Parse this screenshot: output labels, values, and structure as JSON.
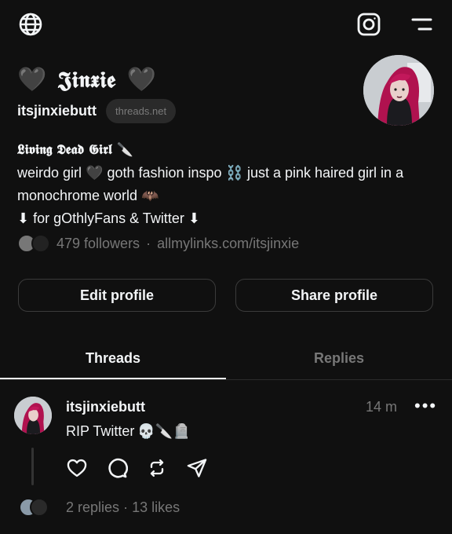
{
  "header": {
    "globe_icon": "globe-icon",
    "instagram_icon": "instagram-icon",
    "menu_icon": "menu-icon"
  },
  "profile": {
    "display_name": "𝕵𝖎𝖓𝖝𝖎𝖊",
    "heart_left": "🖤",
    "heart_right": "🖤",
    "username": "itsjinxiebutt",
    "domain_badge": "threads.net",
    "bio_title": "𝕷𝖎𝖛𝖎𝖓𝖌 𝕯𝖊𝖆𝖉 𝕲𝖎𝖗𝖑 🔪",
    "bio_lines": [
      "weirdo girl 🖤 goth fashion inspo ⛓️  just a pink haired girl in a",
      "monochrome world 🦇",
      "⬇ for gOthlyFans & Twitter ⬇"
    ],
    "followers": "479 followers",
    "separator": "·",
    "link": "allmylinks.com/itsjinxie"
  },
  "actions": {
    "edit_profile": "Edit profile",
    "share_profile": "Share profile"
  },
  "tabs": [
    {
      "label": "Threads",
      "active": true
    },
    {
      "label": "Replies",
      "active": false
    }
  ],
  "post": {
    "username": "itsjinxiebutt",
    "time": "14 m",
    "more": "•••",
    "text": "RIP Twitter",
    "emojis": "💀🔪🪦",
    "replies": "2 replies",
    "likes": "13 likes",
    "stat_separator": "·"
  },
  "colors": {
    "background": "#101010",
    "text": "#f3f5f7",
    "muted": "#777777",
    "border": "#3b3b3b",
    "avatar_hair": "#c2185b"
  }
}
